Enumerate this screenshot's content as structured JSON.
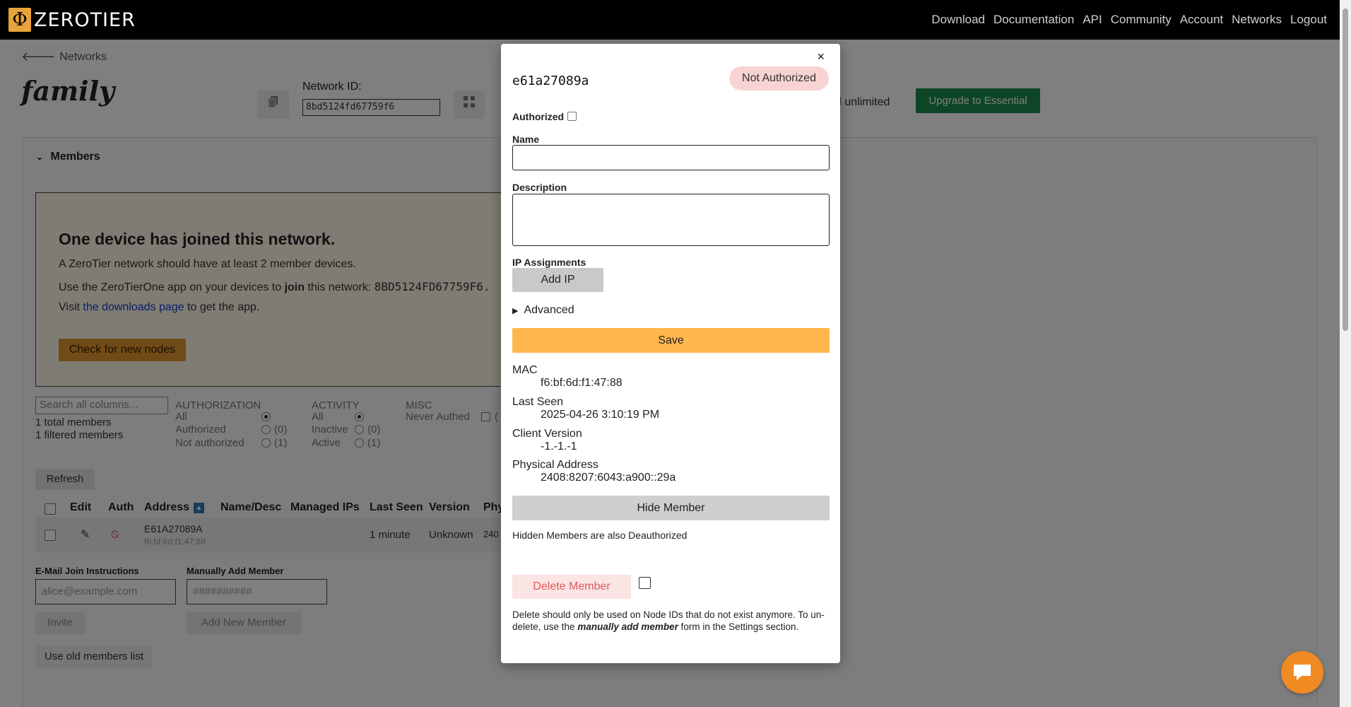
{
  "app": {
    "logo_glyph": "Φ",
    "logo_text": "ZEROTIER",
    "nav": [
      "Download",
      "Documentation",
      "API",
      "Community",
      "Account",
      "Networks",
      "Logout"
    ]
  },
  "page": {
    "back_label": "Networks",
    "network_name": "family",
    "network_id_label": "Network ID:",
    "network_id": "8bd5124fd67759f6",
    "plan_text": "d unlimited",
    "upgrade_label": "Upgrade to Essential",
    "members_header": "Members",
    "joined": {
      "title": "One device has joined this network.",
      "line1": "A ZeroTier network should have at least 2 member devices.",
      "line2_pre": "Use the ZeroTierOne app on your devices to ",
      "line2_bold": "join",
      "line2_post": " this network: ",
      "line2_id": "8BD5124FD67759F6.",
      "line3_pre": "Visit ",
      "line3_link": "the downloads page",
      "line3_post": " to get the app.",
      "check_button": "Check for new nodes"
    },
    "search_placeholder": "Search all columns...",
    "total_members": "1 total members",
    "filtered_members": "1 filtered members",
    "filters": {
      "authorization": {
        "title": "AUTHORIZATION",
        "all": "All",
        "authorized": "Authorized",
        "authorized_count": "(0)",
        "not_authorized": "Not authorized",
        "not_authorized_count": "(1)"
      },
      "activity": {
        "title": "ACTIVITY",
        "all": "All",
        "inactive": "Inactive",
        "inactive_count": "(0)",
        "active": "Active",
        "active_count": "(1)"
      },
      "misc": {
        "title": "MISC",
        "never_authed": "Never Authed",
        "never_authed_count": "("
      }
    },
    "refresh_label": "Refresh",
    "table": {
      "headers": [
        "Edit",
        "Auth",
        "Address",
        "Name/Desc",
        "Managed IPs",
        "Last Seen",
        "Version",
        "Phy"
      ],
      "sort_indicator": "▲",
      "row": {
        "address": "E61A27089A",
        "mac": "f6:bf:6d:f1:47:88",
        "last_seen": "1 minute",
        "version": "Unknown",
        "phy": "240"
      }
    },
    "email_label": "E-Mail Join Instructions",
    "email_placeholder": "alice@example.com",
    "invite_label": "Invite",
    "manual_label": "Manually Add Member",
    "manual_placeholder": "##########",
    "add_member_label": "Add New Member",
    "old_list_label": "Use old members list"
  },
  "modal": {
    "close_glyph": "×",
    "member_id": "e61a27089a",
    "status": "Not Authorized",
    "authorized_label": "Authorized",
    "authorized_checked": false,
    "name_label": "Name",
    "name_value": "",
    "description_label": "Description",
    "description_value": "",
    "ip_label": "IP Assignments",
    "add_ip_label": "Add IP",
    "advanced_label": "Advanced",
    "save_label": "Save",
    "mac_label": "MAC",
    "mac_value": "f6:bf:6d:f1:47:88",
    "last_seen_label": "Last Seen",
    "last_seen_value": "2025-04-26 3:10:19 PM",
    "client_version_label": "Client Version",
    "client_version_value": "-1.-1.-1",
    "physical_address_label": "Physical Address",
    "physical_address_value": "2408:8207:6043:a900::29a",
    "hide_label": "Hide Member",
    "hidden_note": "Hidden Members are also Deauthorized",
    "delete_label": "Delete Member",
    "delete_note_pre": "Delete should only be used on Node IDs that do not exist anymore. To un-delete, use the ",
    "delete_note_em": "manually add member",
    "delete_note_post": " form in the Settings section."
  },
  "colors": {
    "save": "#ffb74d",
    "status_pill": "#f8d3d3",
    "delete_text": "#e05a5a",
    "upgrade": "#1c8a4f",
    "chat": "#f08a22"
  }
}
